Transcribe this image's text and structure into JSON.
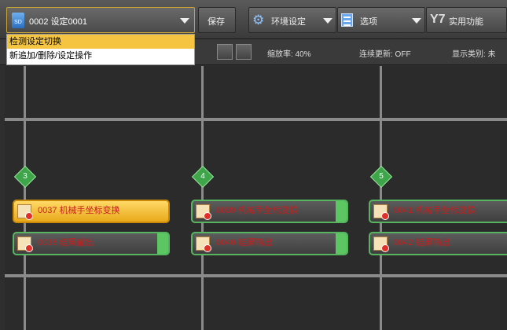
{
  "toolbar": {
    "scene_label": "0002 设定0001",
    "sd_icon_text": "SD",
    "save_label": "保存",
    "env_label": "环境设定",
    "options_label": "选项",
    "utility_label": "实用功能",
    "gear_icon": "⚙",
    "tool_icon": "Y7"
  },
  "dropdown": {
    "items": [
      "检测设定切换",
      "新追加/删除/设定操作"
    ]
  },
  "statusbar": {
    "zoom": "缩放率: 40%",
    "continuous": "连续更新: OFF",
    "display": "显示类别: 未"
  },
  "flow": {
    "columns": [
      {
        "step": "3",
        "units": [
          {
            "label": "0037 机械手坐标变换",
            "selected": true
          },
          {
            "label": "0038 结果输出",
            "selected": false
          }
        ]
      },
      {
        "step": "4",
        "units": [
          {
            "label": "0039 机械手坐标变换",
            "selected": false
          },
          {
            "label": "0040 结果输出",
            "selected": false
          }
        ]
      },
      {
        "step": "5",
        "units": [
          {
            "label": "0041 机械手坐标变换",
            "selected": false
          },
          {
            "label": "0042 结果输出",
            "selected": false
          }
        ]
      }
    ]
  }
}
